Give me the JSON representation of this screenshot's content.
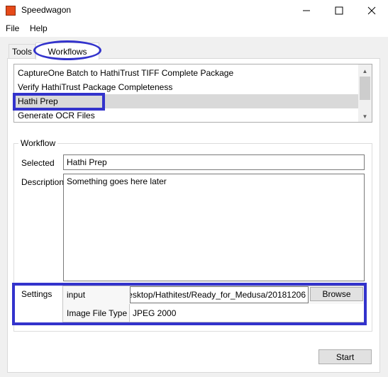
{
  "window": {
    "title": "Speedwagon"
  },
  "menu": {
    "file": "File",
    "help": "Help"
  },
  "tabs": [
    {
      "label": "Tools"
    },
    {
      "label": "Workflows"
    }
  ],
  "workflows": {
    "items": [
      "CaptureOne Batch to HathiTrust TIFF Complete Package",
      "Verify HathiTrust Package Completeness",
      "Hathi Prep",
      "Generate OCR Files"
    ],
    "selected_index": 2
  },
  "workflow_group": {
    "title": "Workflow",
    "selected_label": "Selected",
    "selected_value": "Hathi Prep",
    "description_label": "Description",
    "description_value": "Something goes here later"
  },
  "settings": {
    "label": "Settings",
    "input_label": "input",
    "input_value": "esktop/Hathitest/Ready_for_Medusa/20181206",
    "browse_label": "Browse",
    "image_type_label": "Image File Type",
    "image_type_value": "JPEG 2000"
  },
  "actions": {
    "start_label": "Start"
  },
  "colors": {
    "annotation": "#3333cc",
    "selection": "#d9d9d9",
    "app_icon": "#e64a19"
  }
}
